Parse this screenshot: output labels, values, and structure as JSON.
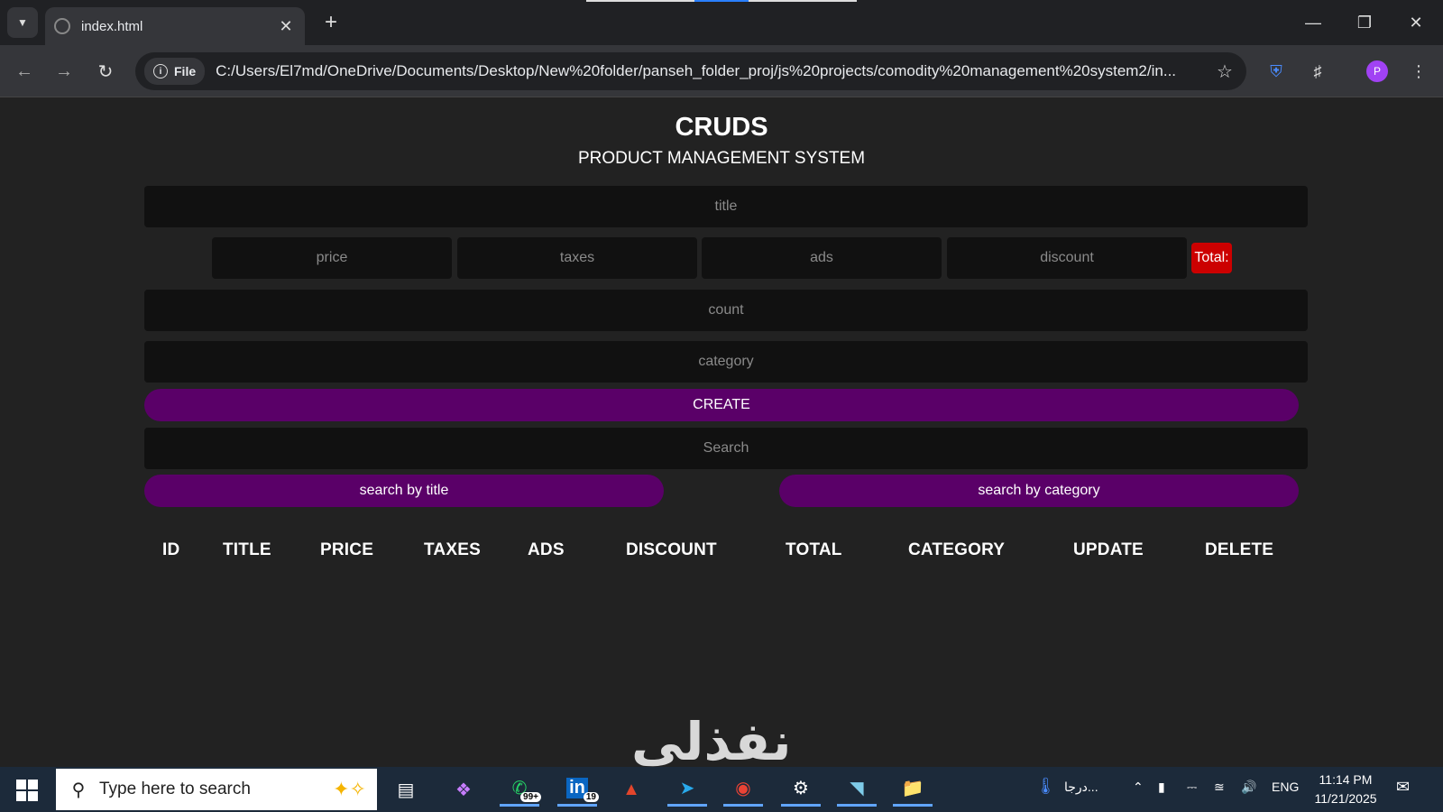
{
  "browser": {
    "tab_title": "index.html",
    "file_chip": "File",
    "url": "C:/Users/El7md/OneDrive/Documents/Desktop/New%20folder/panseh_folder_proj/js%20projects/comodity%20management%20system2/in...",
    "profile_initial": "P"
  },
  "page": {
    "title": "CRUDS",
    "subtitle": "PRODUCT MANAGEMENT SYSTEM",
    "placeholders": {
      "title": "title",
      "price": "price",
      "taxes": "taxes",
      "ads": "ads",
      "discount": "discount",
      "count": "count",
      "category": "category",
      "search": "Search"
    },
    "total_label": "Total:",
    "create_label": "CREATE",
    "search_by_title_label": "search by title",
    "search_by_category_label": "search by category",
    "table_headers": [
      "ID",
      "TITLE",
      "PRICE",
      "TAXES",
      "ADS",
      "DISCOUNT",
      "TOTAL",
      "CATEGORY",
      "UPDATE",
      "DELETE"
    ],
    "colors": {
      "background": "#222222",
      "input": "#111111",
      "button": "#5a0068",
      "total": "#cc0000"
    }
  },
  "watermark": "نفذلي",
  "taskbar": {
    "search_placeholder": "Type here to search",
    "whatsapp_badge": "99+",
    "linkedin_badge": "19",
    "weather_text": "درجا...",
    "language": "ENG",
    "time": "11:14 PM",
    "date": "11/21/2025"
  }
}
